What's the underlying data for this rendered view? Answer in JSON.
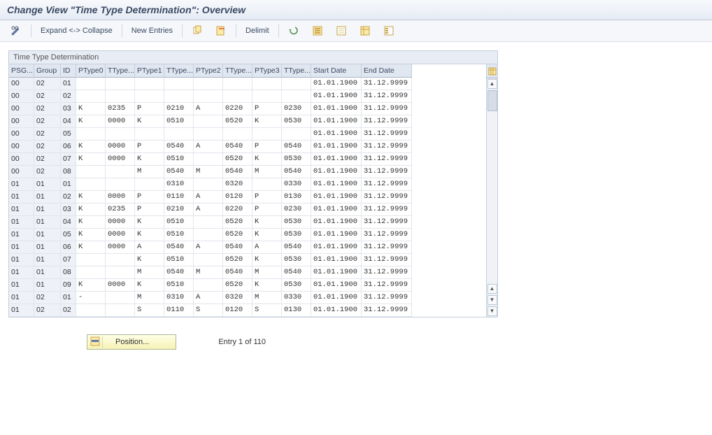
{
  "title": "Change View \"Time Type Determination\": Overview",
  "toolbar": {
    "expand_collapse": "Expand <-> Collapse",
    "new_entries": "New Entries",
    "delimit": "Delimit"
  },
  "panel_header": "Time Type Determination",
  "columns": [
    "PSG...",
    "Group",
    "ID",
    "PType0",
    "TType...",
    "PType1",
    "TType...",
    "PType2",
    "TType...",
    "PType3",
    "TType...",
    "Start Date",
    "End Date"
  ],
  "rows": [
    {
      "psg": "00",
      "group": "02",
      "id": "01",
      "p0": "",
      "t0": "",
      "p1": "",
      "t1": "",
      "p2": "",
      "t2": "",
      "p3": "",
      "t3": "",
      "start": "01.01.1900",
      "end": "31.12.9999"
    },
    {
      "psg": "00",
      "group": "02",
      "id": "02",
      "p0": "",
      "t0": "",
      "p1": "",
      "t1": "",
      "p2": "",
      "t2": "",
      "p3": "",
      "t3": "",
      "start": "01.01.1900",
      "end": "31.12.9999"
    },
    {
      "psg": "00",
      "group": "02",
      "id": "03",
      "p0": "K",
      "t0": "0235",
      "p1": "P",
      "t1": "0210",
      "p2": "A",
      "t2": "0220",
      "p3": "P",
      "t3": "0230",
      "start": "01.01.1900",
      "end": "31.12.9999"
    },
    {
      "psg": "00",
      "group": "02",
      "id": "04",
      "p0": "K",
      "t0": "0000",
      "p1": "K",
      "t1": "0510",
      "p2": "",
      "t2": "0520",
      "p3": "K",
      "t3": "0530",
      "start": "01.01.1900",
      "end": "31.12.9999"
    },
    {
      "psg": "00",
      "group": "02",
      "id": "05",
      "p0": "",
      "t0": "",
      "p1": "",
      "t1": "",
      "p2": "",
      "t2": "",
      "p3": "",
      "t3": "",
      "start": "01.01.1900",
      "end": "31.12.9999"
    },
    {
      "psg": "00",
      "group": "02",
      "id": "06",
      "p0": "K",
      "t0": "0000",
      "p1": "P",
      "t1": "0540",
      "p2": "A",
      "t2": "0540",
      "p3": "P",
      "t3": "0540",
      "start": "01.01.1900",
      "end": "31.12.9999"
    },
    {
      "psg": "00",
      "group": "02",
      "id": "07",
      "p0": "K",
      "t0": "0000",
      "p1": "K",
      "t1": "0510",
      "p2": "",
      "t2": "0520",
      "p3": "K",
      "t3": "0530",
      "start": "01.01.1900",
      "end": "31.12.9999"
    },
    {
      "psg": "00",
      "group": "02",
      "id": "08",
      "p0": "",
      "t0": "",
      "p1": "M",
      "t1": "0540",
      "p2": "M",
      "t2": "0540",
      "p3": "M",
      "t3": "0540",
      "start": "01.01.1900",
      "end": "31.12.9999"
    },
    {
      "psg": "01",
      "group": "01",
      "id": "01",
      "p0": "",
      "t0": "",
      "p1": "",
      "t1": "0310",
      "p2": "",
      "t2": "0320",
      "p3": "",
      "t3": "0330",
      "start": "01.01.1900",
      "end": "31.12.9999"
    },
    {
      "psg": "01",
      "group": "01",
      "id": "02",
      "p0": "K",
      "t0": "0000",
      "p1": "P",
      "t1": "0110",
      "p2": "A",
      "t2": "0120",
      "p3": "P",
      "t3": "0130",
      "start": "01.01.1900",
      "end": "31.12.9999"
    },
    {
      "psg": "01",
      "group": "01",
      "id": "03",
      "p0": "K",
      "t0": "0235",
      "p1": "P",
      "t1": "0210",
      "p2": "A",
      "t2": "0220",
      "p3": "P",
      "t3": "0230",
      "start": "01.01.1900",
      "end": "31.12.9999"
    },
    {
      "psg": "01",
      "group": "01",
      "id": "04",
      "p0": "K",
      "t0": "0000",
      "p1": "K",
      "t1": "0510",
      "p2": "",
      "t2": "0520",
      "p3": "K",
      "t3": "0530",
      "start": "01.01.1900",
      "end": "31.12.9999"
    },
    {
      "psg": "01",
      "group": "01",
      "id": "05",
      "p0": "K",
      "t0": "0000",
      "p1": "K",
      "t1": "0510",
      "p2": "",
      "t2": "0520",
      "p3": "K",
      "t3": "0530",
      "start": "01.01.1900",
      "end": "31.12.9999"
    },
    {
      "psg": "01",
      "group": "01",
      "id": "06",
      "p0": "K",
      "t0": "0000",
      "p1": "A",
      "t1": "0540",
      "p2": "A",
      "t2": "0540",
      "p3": "A",
      "t3": "0540",
      "start": "01.01.1900",
      "end": "31.12.9999"
    },
    {
      "psg": "01",
      "group": "01",
      "id": "07",
      "p0": "",
      "t0": "",
      "p1": "K",
      "t1": "0510",
      "p2": "",
      "t2": "0520",
      "p3": "K",
      "t3": "0530",
      "start": "01.01.1900",
      "end": "31.12.9999"
    },
    {
      "psg": "01",
      "group": "01",
      "id": "08",
      "p0": "",
      "t0": "",
      "p1": "M",
      "t1": "0540",
      "p2": "M",
      "t2": "0540",
      "p3": "M",
      "t3": "0540",
      "start": "01.01.1900",
      "end": "31.12.9999"
    },
    {
      "psg": "01",
      "group": "01",
      "id": "09",
      "p0": "K",
      "t0": "0000",
      "p1": "K",
      "t1": "0510",
      "p2": "",
      "t2": "0520",
      "p3": "K",
      "t3": "0530",
      "start": "01.01.1900",
      "end": "31.12.9999"
    },
    {
      "psg": "01",
      "group": "02",
      "id": "01",
      "p0": "-",
      "t0": "",
      "p1": "M",
      "t1": "0310",
      "p2": "A",
      "t2": "0320",
      "p3": "M",
      "t3": "0330",
      "start": "01.01.1900",
      "end": "31.12.9999"
    },
    {
      "psg": "01",
      "group": "02",
      "id": "02",
      "p0": "",
      "t0": "",
      "p1": "S",
      "t1": "0110",
      "p2": "S",
      "t2": "0120",
      "p3": "S",
      "t3": "0130",
      "start": "01.01.1900",
      "end": "31.12.9999"
    }
  ],
  "footer": {
    "position_label": "Position...",
    "entry_text": "Entry 1 of 110"
  },
  "watermark": ""
}
